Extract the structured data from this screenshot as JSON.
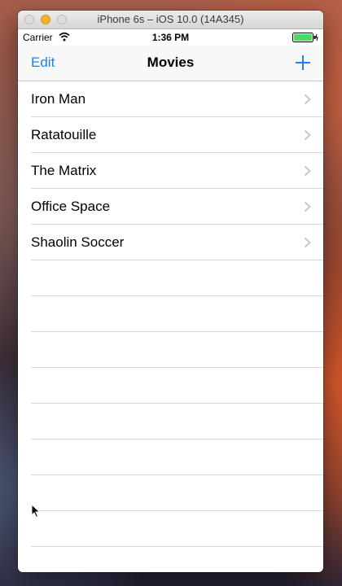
{
  "window": {
    "title": "iPhone 6s – iOS 10.0 (14A345)"
  },
  "status_bar": {
    "carrier": "Carrier",
    "time": "1:36 PM",
    "wifi_icon": "wifi-icon",
    "battery_icon": "battery-icon"
  },
  "nav_bar": {
    "left_button": "Edit",
    "title": "Movies",
    "right_icon": "plus-icon"
  },
  "movies": [
    {
      "title": "Iron Man"
    },
    {
      "title": "Ratatouille"
    },
    {
      "title": "The Matrix"
    },
    {
      "title": "Office Space"
    },
    {
      "title": "Shaolin Soccer"
    }
  ],
  "colors": {
    "tint": "#1a82fb",
    "separator": "#d9d9de",
    "battery": "#4cd964"
  }
}
